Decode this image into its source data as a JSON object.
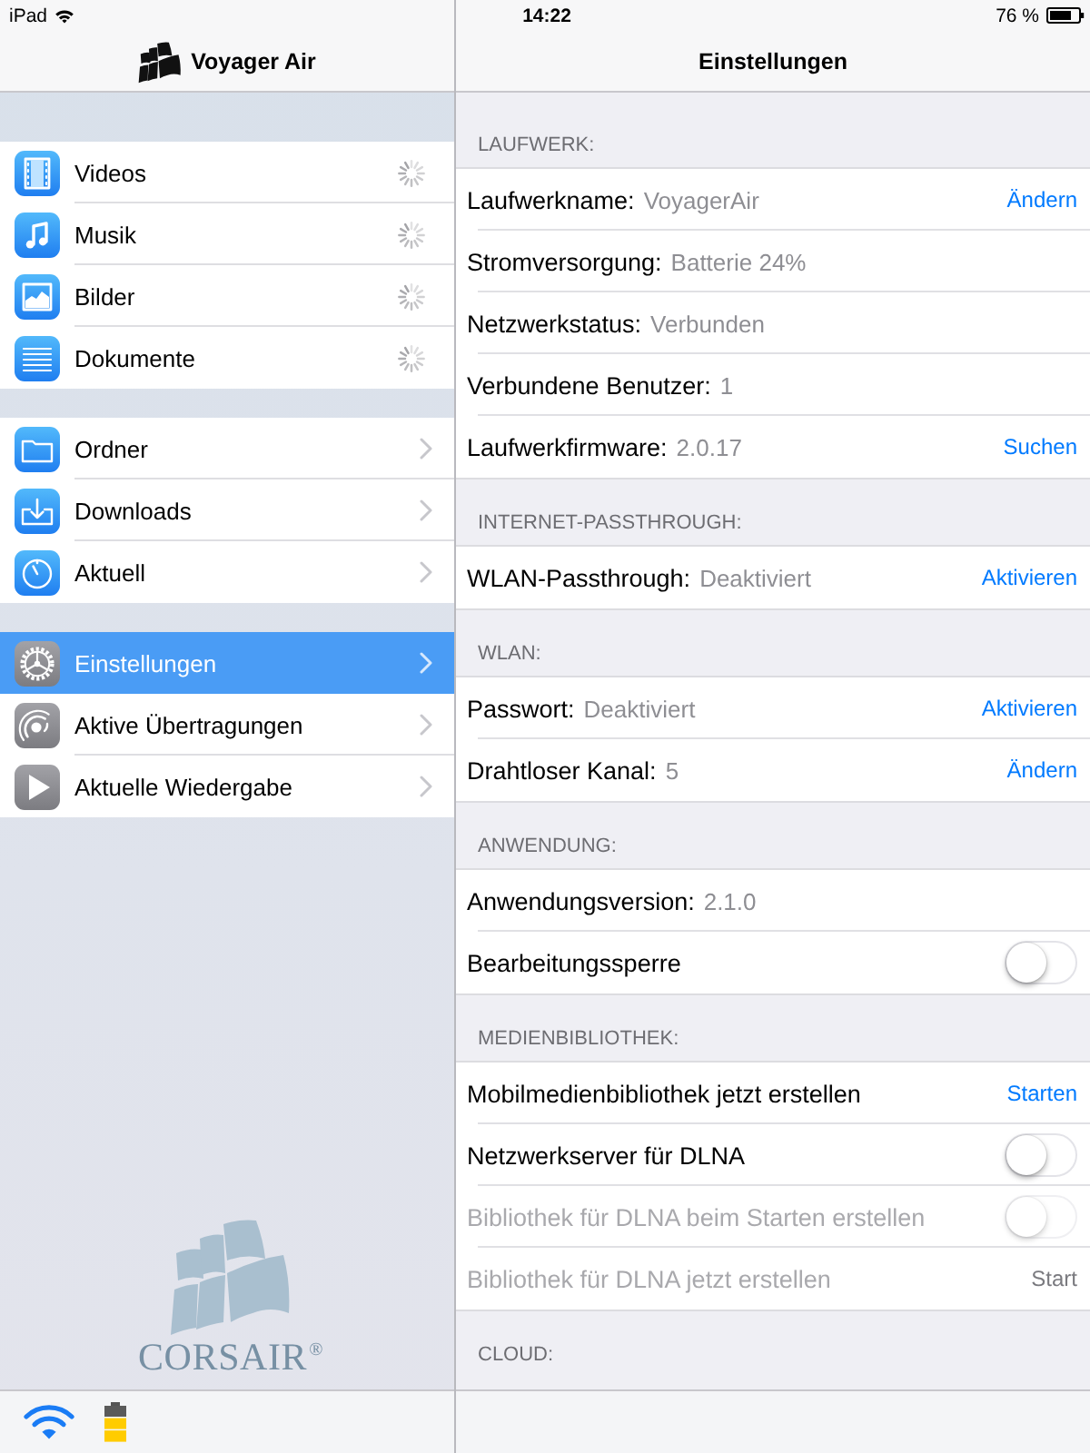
{
  "status_bar": {
    "device": "iPad",
    "time": "14:22",
    "battery": "76 %"
  },
  "sidebar": {
    "title": "Voyager Air",
    "groups": [
      {
        "items": [
          {
            "label": "Videos",
            "loading": true,
            "selected": false
          },
          {
            "label": "Musik",
            "loading": true,
            "selected": false
          },
          {
            "label": "Bilder",
            "loading": true,
            "selected": false
          },
          {
            "label": "Dokumente",
            "loading": true,
            "selected": false
          }
        ]
      },
      {
        "items": [
          {
            "label": "Ordner",
            "loading": false,
            "selected": false
          },
          {
            "label": "Downloads",
            "loading": false,
            "selected": false
          },
          {
            "label": "Aktuell",
            "loading": false,
            "selected": false
          }
        ]
      },
      {
        "items": [
          {
            "label": "Einstellungen",
            "loading": false,
            "selected": true
          },
          {
            "label": "Aktive Übertragungen",
            "loading": false,
            "selected": false
          },
          {
            "label": "Aktuelle Wiedergabe",
            "loading": false,
            "selected": false
          }
        ]
      }
    ],
    "brand": "CORSAIR$^{®}$"
  },
  "settings": {
    "title": "Einstellungen",
    "sections": [
      {
        "header": "LAUFWERK:",
        "rows": [
          {
            "kind": "info",
            "label": "Laufwerkname:",
            "value": "VoyagerAir",
            "action": "Ändern"
          },
          {
            "kind": "info",
            "label": "Stromversorgung:",
            "value": "Batterie 24%"
          },
          {
            "kind": "info",
            "label": "Netzwerkstatus:",
            "value": "Verbunden"
          },
          {
            "kind": "info",
            "label": "Verbundene Benutzer:",
            "value": "1"
          },
          {
            "kind": "info",
            "label": "Laufwerkfirmware:",
            "value": "2.0.17",
            "action": "Suchen"
          }
        ]
      },
      {
        "header": "INTERNET-PASSTHROUGH:",
        "rows": [
          {
            "kind": "info",
            "label": "WLAN-Passthrough:",
            "value": "Deaktiviert",
            "action": "Aktivieren"
          }
        ]
      },
      {
        "header": "WLAN:",
        "rows": [
          {
            "kind": "info",
            "label": "Passwort:",
            "value": "Deaktiviert",
            "action": "Aktivieren"
          },
          {
            "kind": "info",
            "label": "Drahtloser Kanal:",
            "value": "5",
            "action": "Ändern"
          }
        ]
      },
      {
        "header": "ANWENDUNG:",
        "rows": [
          {
            "kind": "info",
            "label": "Anwendungsversion:",
            "value": "2.1.0"
          },
          {
            "kind": "toggle",
            "label": "Bearbeitungssperre",
            "on": false
          }
        ]
      },
      {
        "header": "MEDIENBIBLIOTHEK:",
        "rows": [
          {
            "kind": "info",
            "label": "Mobilmedienbibliothek jetzt erstellen",
            "action": "Starten",
            "disabled": false
          },
          {
            "kind": "toggle",
            "label": "Netzwerkserver für DLNA",
            "on": false,
            "disabled": false
          },
          {
            "kind": "toggle",
            "label": "Bibliothek für DLNA beim Starten erstellen",
            "on": false,
            "disabled": true
          },
          {
            "kind": "info",
            "label": "Bibliothek für DLNA jetzt erstellen",
            "action": "Start",
            "disabled": true
          }
        ]
      },
      {
        "header": "CLOUD:"
      }
    ]
  }
}
